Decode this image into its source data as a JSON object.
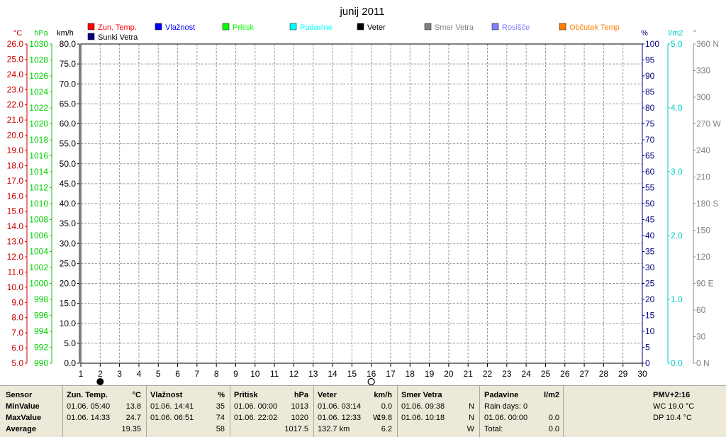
{
  "chart_data": {
    "type": "line",
    "title": "junij 2011",
    "x": {
      "min": 1,
      "max": 30,
      "ticks": [
        1,
        2,
        3,
        4,
        5,
        6,
        7,
        8,
        9,
        10,
        11,
        12,
        13,
        14,
        15,
        16,
        17,
        18,
        19,
        20,
        21,
        22,
        23,
        24,
        25,
        26,
        27,
        28,
        29,
        30
      ]
    },
    "axes_left": [
      {
        "unit": "°C",
        "color": "#CC0000",
        "min": 5.0,
        "max": 26.0,
        "step": 1.0,
        "decimals": 1
      },
      {
        "unit": "hPa",
        "color": "#00CC00",
        "min": 990,
        "max": 1030,
        "step": 2,
        "decimals": 0
      },
      {
        "unit": "km/h",
        "color": "#000000",
        "min": 0.0,
        "max": 80.0,
        "step": 5.0,
        "decimals": 1
      }
    ],
    "axes_right": [
      {
        "unit": "%",
        "color": "#000080",
        "min": 0,
        "max": 100,
        "step": 5,
        "decimals": 0
      },
      {
        "unit": "l/m2",
        "color": "#00CCCC",
        "min": 0.0,
        "max": 5.0,
        "step": 1.0,
        "decimals": 1
      },
      {
        "unit": "°",
        "color": "#808080",
        "min": 0,
        "max": 360,
        "step": 30,
        "decimals": 0,
        "labels": [
          "0 N",
          "30",
          "60",
          "90 E",
          "120",
          "150",
          "180 S",
          "210",
          "240",
          "270 W",
          "300",
          "330",
          "360 N"
        ]
      }
    ],
    "grid": true,
    "legend": [
      {
        "name": "Zun. Temp.",
        "color": "#FF0000"
      },
      {
        "name": "Vlažnost",
        "color": "#0000FF"
      },
      {
        "name": "Pritisk",
        "color": "#00FF00"
      },
      {
        "name": "Padavine",
        "color": "#00FFFF"
      },
      {
        "name": "Veter",
        "color": "#000000"
      },
      {
        "name": "Smer Vetra",
        "color": "#808080"
      },
      {
        "name": "Rosišče",
        "color": "#8080FF"
      },
      {
        "name": "Občutek Temp",
        "color": "#FF8000"
      },
      {
        "name": "Sunki Vetra",
        "color": "#000080"
      }
    ],
    "moon_markers": [
      {
        "x": 2,
        "phase": "new"
      },
      {
        "x": 16,
        "phase": "full"
      }
    ],
    "series": []
  },
  "stats": {
    "row_labels": {
      "sensor": "Sensor",
      "min": "MinValue",
      "max": "MaxValue",
      "avg": "Average"
    },
    "temp": {
      "title": "Zun. Temp.",
      "unit": "°C",
      "min_time": "01.06.  05:40",
      "min_val": "13.8",
      "max_time": "01.06.  14:33",
      "max_val": "24.7",
      "avg": "19.35"
    },
    "hum": {
      "title": "Vlažnost",
      "unit": "%",
      "min_time": "01.06.  14:41",
      "min_val": "35",
      "max_time": "01.06.  06:51",
      "max_val": "74",
      "avg": "58"
    },
    "press": {
      "title": "Pritisk",
      "unit": "hPa",
      "min_time": "01.06.  00:00",
      "min_val": "1013",
      "max_time": "01.06.  22:02",
      "max_val": "1020",
      "avg": "1017.5"
    },
    "wind": {
      "title": "Veter",
      "unit": "km/h",
      "min_time": "01.06.  03:14",
      "min_val": "0.0",
      "max_time": "01.06.  12:33",
      "max_dir": "W",
      "max_val": "19.8",
      "avg_dist": "132.7 km",
      "avg": "6.2"
    },
    "dir": {
      "title": "Smer Vetra",
      "min_time": "01.06.  09:38",
      "min_val": "N",
      "max_time": "01.06.  10:18",
      "max_val": "N",
      "avg": "W"
    },
    "rain": {
      "title": "Padavine",
      "unit": "l/m2",
      "days_label": "Rain days:",
      "days": "0",
      "max_time": "01.06.  00:00",
      "max_val": "0.0",
      "total_label": "Total:",
      "total": "0.0"
    },
    "pmv": {
      "title": "PMV+2:16",
      "wc": "WC 19.0 °C",
      "dp": "DP 10.4 °C"
    }
  }
}
